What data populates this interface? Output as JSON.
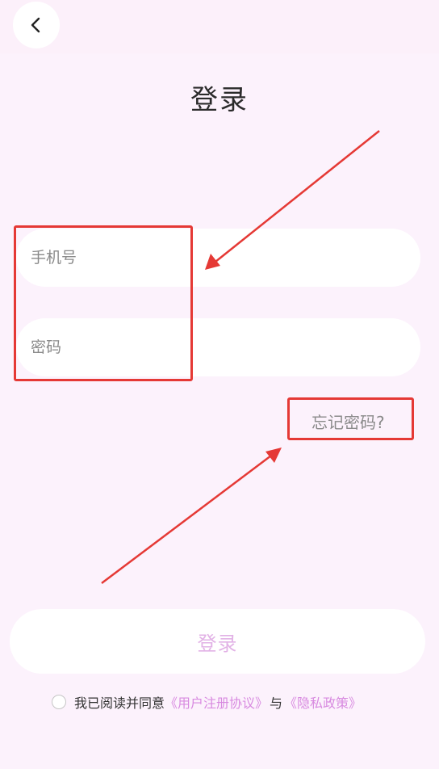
{
  "header": {
    "back_icon": "chevron-left-icon"
  },
  "page": {
    "title": "登录"
  },
  "form": {
    "phone_placeholder": "手机号",
    "password_placeholder": "密码",
    "forgot_password": "忘记密码?"
  },
  "actions": {
    "login_label": "登录"
  },
  "agreement": {
    "prefix": "我已阅读并同意",
    "user_agreement": "《用户注册协议》",
    "conjunction": "与",
    "privacy_policy": "《隐私政策》"
  },
  "colors": {
    "background": "#fcf2fc",
    "link": "#d88ae0",
    "login_disabled_text": "#e2b2e6",
    "annotation": "#e53935"
  }
}
